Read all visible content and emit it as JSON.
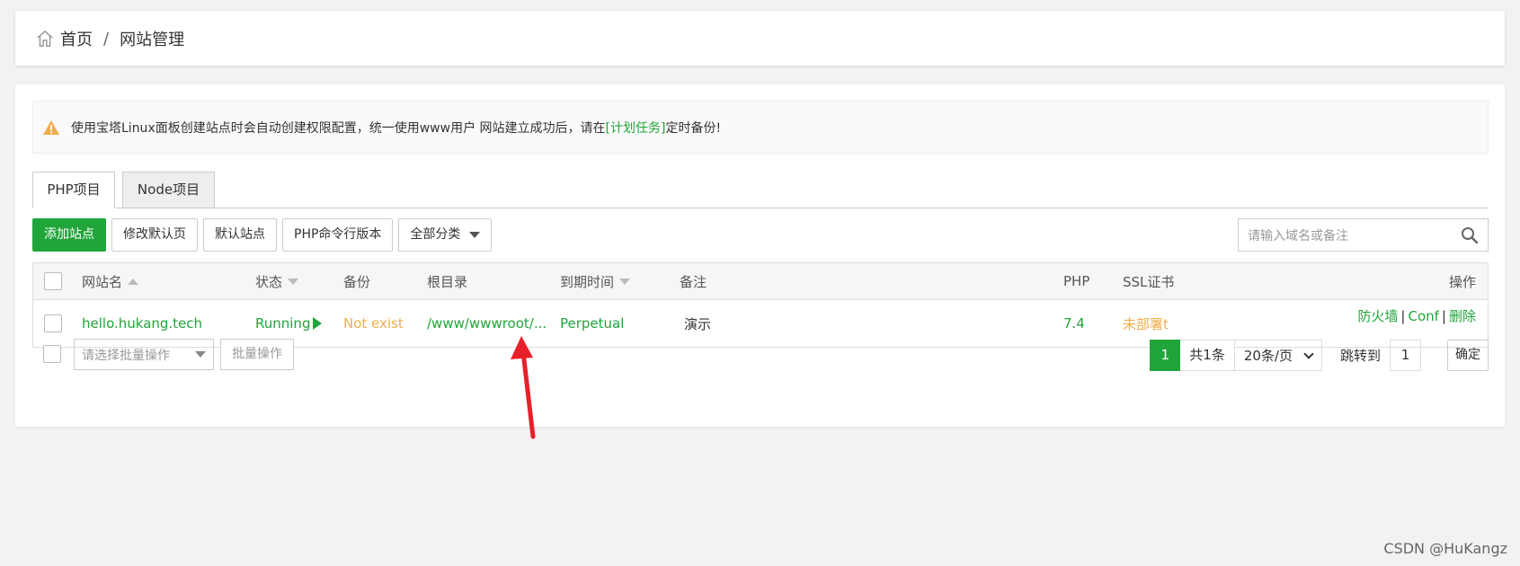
{
  "breadcrumb": {
    "home": "首页",
    "separator": "/",
    "current": "网站管理"
  },
  "notice": {
    "text_before": "使用宝塔Linux面板创建站点时会自动创建权限配置，统一使用www用户 网站建立成功后，请在",
    "link": "[计划任务]",
    "text_after": "定时备份!"
  },
  "tabs": [
    {
      "label": "PHP项目"
    },
    {
      "label": "Node项目"
    }
  ],
  "toolbar": {
    "add_site": "添加站点",
    "edit_default_page": "修改默认页",
    "default_site": "默认站点",
    "php_cli_version": "PHP命令行版本",
    "category_select": "全部分类"
  },
  "search": {
    "placeholder": "请输入域名或备注"
  },
  "table": {
    "headers": {
      "name": "网站名",
      "status": "状态",
      "backup": "备份",
      "root": "根目录",
      "expire": "到期时间",
      "remark": "备注",
      "php": "PHP",
      "ssl": "SSL证书",
      "ops": "操作"
    },
    "rows": [
      {
        "name": "hello.hukang.tech",
        "status": "Running",
        "backup": "Not exist",
        "root": "/www/wwwroot/...",
        "expire": "Perpetual",
        "remark": "演示",
        "php": "7.4",
        "ssl": "未部署t",
        "ops": {
          "firewall": "防火墙",
          "conf": "Conf",
          "delete": "删除",
          "sep": "|"
        }
      }
    ]
  },
  "footer": {
    "batch_select_placeholder": "请选择批量操作",
    "batch_button": "批量操作",
    "page_current": "1",
    "total": "共1条",
    "per_page": "20条/页",
    "jump_label": "跳转到",
    "jump_value": "1",
    "confirm": "确定"
  },
  "watermark": "CSDN @HuKangz",
  "colors": {
    "accent": "#20a53a",
    "warning": "#f0ad4e",
    "annotation_arrow": "#e8202a"
  }
}
